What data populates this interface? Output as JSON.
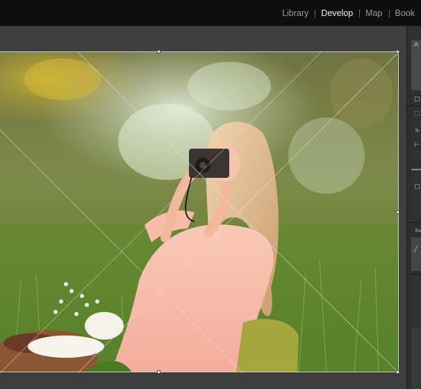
{
  "topbar": {
    "modules": [
      {
        "label": "Library",
        "active": false
      },
      {
        "label": "Develop",
        "active": true
      },
      {
        "label": "Map",
        "active": false
      },
      {
        "label": "Book",
        "active": false
      }
    ]
  },
  "right_panel": {
    "tools_header": "To",
    "tone_header": "Tre",
    "histogram_label": "A"
  },
  "colors": {
    "top_bar": "#0e0e0e",
    "panel_bg": "#3a3a3a",
    "crop_overlay": "#e0e0e0"
  }
}
